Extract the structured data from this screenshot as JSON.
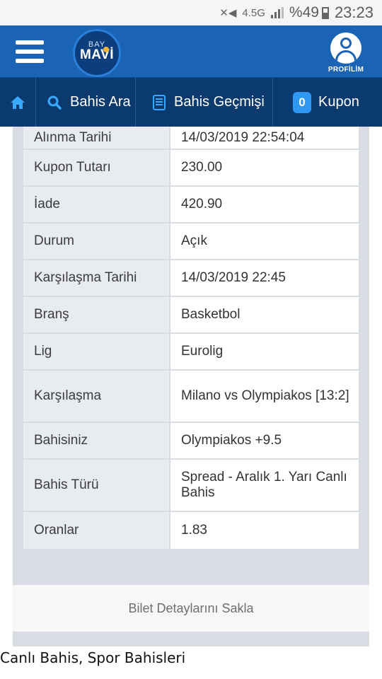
{
  "status_bar": {
    "network": "4.5G",
    "battery": "%49",
    "time": "23:23"
  },
  "header": {
    "logo_top": "BAY",
    "logo_main": "MAVİ",
    "profile_label": "PROFİLİM"
  },
  "nav": {
    "search_label": "Bahis Ara",
    "history_label": "Bahis Geçmişi",
    "kupon_count": "0",
    "kupon_label": "Kupon"
  },
  "details": {
    "rows": [
      {
        "label": "Alınma Tarihi",
        "value": "14/03/2019 22:54:04"
      },
      {
        "label": "Kupon Tutarı",
        "value": "230.00"
      },
      {
        "label": "İade",
        "value": "420.90"
      },
      {
        "label": "Durum",
        "value": "Açık"
      },
      {
        "label": "Karşılaşma Tarihi",
        "value": "14/03/2019 22:45"
      },
      {
        "label": "Branş",
        "value": "Basketbol"
      },
      {
        "label": "Lig",
        "value": "Eurolig"
      },
      {
        "label": "Karşılaşma",
        "value": "Milano vs Olympiakos [13:2]"
      },
      {
        "label": "Bahisiniz",
        "value": "Olympiakos +9.5"
      },
      {
        "label": "Bahis Türü",
        "value": "Spread - Aralık 1. Yarı Canlı Bahis"
      },
      {
        "label": "Oranlar",
        "value": "1.83"
      }
    ]
  },
  "hide_button_label": "Bilet Detaylarını Sakla",
  "caption": "Canlı Bahis, Spor Bahisleri",
  "colors": {
    "header_blue": "#1a63b5",
    "nav_dark": "#0a3a6e",
    "accent_blue": "#2e98f2"
  }
}
